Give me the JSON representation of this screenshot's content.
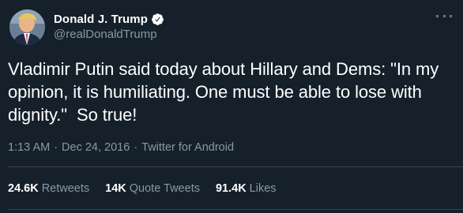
{
  "colors": {
    "background": "#15202b",
    "text_primary": "#ffffff",
    "text_secondary": "#8899a6",
    "divider": "#38444d",
    "verified_badge": "#ffffff"
  },
  "author": {
    "display_name": "Donald J. Trump",
    "handle": "@realDonaldTrump",
    "verified": true,
    "avatar_icon": "profile-photo"
  },
  "tweet": {
    "text": "Vladimir Putin said today about Hillary and Dems: \"In my opinion, it is humiliating. One must be able to lose with dignity.\"  So true!",
    "time": "1:13 AM",
    "date": "Dec 24, 2016",
    "separator": "·",
    "source": "Twitter for Android"
  },
  "stats": {
    "retweets_count": "24.6K",
    "retweets_label": "Retweets",
    "quotes_count": "14K",
    "quotes_label": "Quote Tweets",
    "likes_count": "91.4K",
    "likes_label": "Likes"
  },
  "more_icon": "more-dots-icon"
}
